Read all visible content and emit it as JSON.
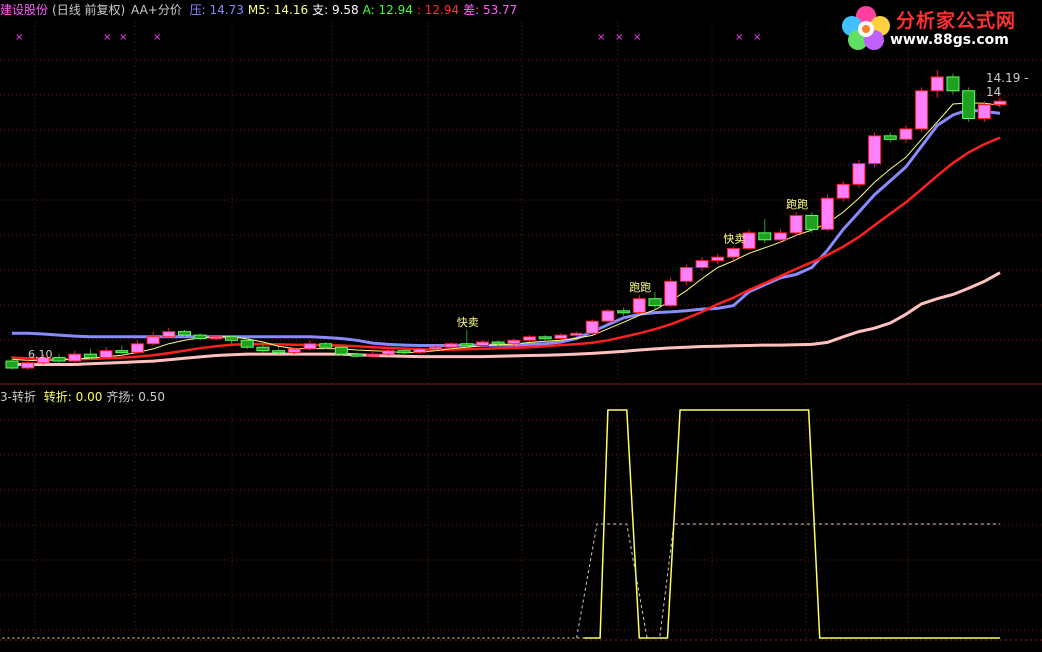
{
  "header": {
    "stock_name": "建设股份",
    "period": "(日线 前复权)",
    "indicator": "AA+分价",
    "items": [
      {
        "label": "压:",
        "value": "14.73",
        "color": "#8a8aff"
      },
      {
        "label": "M5:",
        "value": "14.16",
        "color": "#ffff80"
      },
      {
        "label": "支:",
        "value": "9.58",
        "color": "#ffffff"
      },
      {
        "label": "A:",
        "value": "12.94",
        "color": "#40ff40"
      },
      {
        "label": ":",
        "value": "12.94",
        "color": "#ff3030"
      },
      {
        "label": "差:",
        "value": "53.77",
        "color": "#ff60ff"
      }
    ]
  },
  "logo": {
    "title": "分析家公式网",
    "url": "www.88gs.com"
  },
  "price_labels": {
    "low_marker": "6.10",
    "high_marker": "14.19 - 14"
  },
  "signals": [
    {
      "text": "快卖",
      "day": 29
    },
    {
      "text": "跑跑",
      "day": 40
    },
    {
      "text": "快卖",
      "day": 46
    },
    {
      "text": "跑跑",
      "day": 50
    }
  ],
  "sub_header": {
    "name": "3-转折",
    "items": [
      {
        "label": "转折:",
        "value": "0.00",
        "color": "#ffff60"
      },
      {
        "label": "齐扬:",
        "value": "0.50",
        "color": "#cccccc"
      }
    ]
  },
  "colors": {
    "background": "#000000",
    "up_candle": "#ff80ff",
    "down_candle": "#20a020",
    "upper_band": "#8a8aff",
    "ma_fast": "#ffff80",
    "ma_mid": "#ff2020",
    "ma_slow": "#ffc0c0",
    "grid": "#6a1a1a",
    "indicator_line": "#ffff60",
    "indicator_dash": "#cccccc"
  },
  "chart_data": {
    "type": "candlestick",
    "days": 64,
    "price_range": [
      6.0,
      14.6
    ],
    "candles": [
      [
        6.2,
        6.0,
        6.35,
        5.95
      ],
      [
        6.0,
        6.15,
        6.25,
        5.95
      ],
      [
        6.15,
        6.3,
        6.4,
        6.1
      ],
      [
        6.3,
        6.2,
        6.4,
        6.15
      ],
      [
        6.2,
        6.4,
        6.5,
        6.15
      ],
      [
        6.4,
        6.3,
        6.55,
        6.25
      ],
      [
        6.3,
        6.5,
        6.6,
        6.25
      ],
      [
        6.5,
        6.45,
        6.65,
        6.4
      ],
      [
        6.45,
        6.7,
        6.8,
        6.4
      ],
      [
        6.7,
        6.9,
        7.05,
        6.65
      ],
      [
        6.9,
        7.05,
        7.15,
        6.85
      ],
      [
        7.05,
        6.95,
        7.1,
        6.9
      ],
      [
        6.95,
        6.85,
        7.0,
        6.8
      ],
      [
        6.85,
        6.9,
        6.95,
        6.8
      ],
      [
        6.9,
        6.8,
        6.95,
        6.7
      ],
      [
        6.8,
        6.6,
        6.85,
        6.55
      ],
      [
        6.6,
        6.5,
        6.7,
        6.45
      ],
      [
        6.5,
        6.45,
        6.6,
        6.4
      ],
      [
        6.45,
        6.55,
        6.6,
        6.4
      ],
      [
        6.55,
        6.7,
        6.8,
        6.5
      ],
      [
        6.7,
        6.6,
        6.75,
        6.55
      ],
      [
        6.6,
        6.4,
        6.65,
        6.35
      ],
      [
        6.4,
        6.35,
        6.45,
        6.3
      ],
      [
        6.35,
        6.4,
        6.5,
        6.3
      ],
      [
        6.4,
        6.5,
        6.55,
        6.35
      ],
      [
        6.5,
        6.45,
        6.55,
        6.4
      ],
      [
        6.45,
        6.55,
        6.6,
        6.4
      ],
      [
        6.55,
        6.6,
        6.65,
        6.5
      ],
      [
        6.6,
        6.7,
        6.75,
        6.55
      ],
      [
        6.7,
        6.65,
        7.1,
        6.6
      ],
      [
        6.65,
        6.75,
        6.8,
        6.6
      ],
      [
        6.75,
        6.7,
        6.8,
        6.65
      ],
      [
        6.7,
        6.8,
        6.85,
        6.65
      ],
      [
        6.8,
        6.9,
        6.95,
        6.75
      ],
      [
        6.9,
        6.85,
        6.95,
        6.8
      ],
      [
        6.85,
        6.95,
        7.0,
        6.8
      ],
      [
        6.95,
        7.0,
        7.05,
        6.9
      ],
      [
        7.0,
        7.35,
        7.4,
        6.95
      ],
      [
        7.35,
        7.65,
        7.7,
        7.3
      ],
      [
        7.65,
        7.6,
        7.75,
        7.5
      ],
      [
        7.6,
        8.0,
        8.1,
        7.55
      ],
      [
        8.0,
        7.8,
        8.2,
        7.7
      ],
      [
        7.8,
        8.5,
        8.6,
        7.75
      ],
      [
        8.5,
        8.9,
        9.0,
        8.4
      ],
      [
        8.9,
        9.1,
        9.2,
        8.8
      ],
      [
        9.1,
        9.2,
        9.3,
        9.0
      ],
      [
        9.2,
        9.45,
        9.5,
        9.1
      ],
      [
        9.45,
        9.9,
        10.0,
        9.4
      ],
      [
        9.9,
        9.7,
        10.3,
        9.6
      ],
      [
        9.7,
        9.9,
        10.0,
        9.6
      ],
      [
        9.9,
        10.4,
        10.5,
        9.8
      ],
      [
        10.4,
        10.0,
        10.5,
        9.9
      ],
      [
        10.0,
        10.9,
        11.0,
        9.95
      ],
      [
        10.9,
        11.3,
        11.4,
        10.8
      ],
      [
        11.3,
        11.9,
        12.0,
        11.2
      ],
      [
        11.9,
        12.7,
        12.8,
        11.8
      ],
      [
        12.7,
        12.6,
        12.8,
        12.5
      ],
      [
        12.6,
        12.9,
        13.0,
        12.5
      ],
      [
        12.9,
        14.0,
        14.1,
        12.8
      ],
      [
        14.0,
        14.4,
        14.6,
        13.8
      ],
      [
        14.4,
        14.0,
        14.5,
        13.9
      ],
      [
        14.0,
        13.2,
        14.1,
        13.1
      ],
      [
        13.2,
        13.6,
        13.7,
        13.1
      ],
      [
        13.6,
        13.7,
        13.8,
        13.5
      ]
    ],
    "upper_band": [
      7.0,
      7.0,
      6.98,
      6.95,
      6.92,
      6.9,
      6.9,
      6.9,
      6.9,
      6.9,
      6.9,
      6.9,
      6.9,
      6.9,
      6.9,
      6.9,
      6.9,
      6.9,
      6.9,
      6.9,
      6.88,
      6.85,
      6.8,
      6.72,
      6.68,
      6.66,
      6.65,
      6.65,
      6.65,
      6.66,
      6.66,
      6.66,
      6.66,
      6.68,
      6.7,
      6.75,
      6.85,
      7.05,
      7.25,
      7.45,
      7.55,
      7.6,
      7.62,
      7.65,
      7.7,
      7.72,
      7.8,
      8.2,
      8.4,
      8.6,
      8.7,
      8.9,
      9.4,
      10.0,
      10.5,
      11.0,
      11.4,
      11.8,
      12.4,
      13.0,
      13.3,
      13.45,
      13.4,
      13.35
    ],
    "ma_fast": [
      6.25,
      6.22,
      6.22,
      6.23,
      6.26,
      6.28,
      6.33,
      6.37,
      6.45,
      6.55,
      6.7,
      6.8,
      6.87,
      6.9,
      6.9,
      6.84,
      6.75,
      6.63,
      6.56,
      6.56,
      6.56,
      6.55,
      6.52,
      6.5,
      6.48,
      6.44,
      6.46,
      6.5,
      6.56,
      6.6,
      6.64,
      6.67,
      6.68,
      6.74,
      6.77,
      6.8,
      6.86,
      6.94,
      7.13,
      7.32,
      7.52,
      7.68,
      7.93,
      8.23,
      8.58,
      8.9,
      9.09,
      9.31,
      9.47,
      9.63,
      9.83,
      9.98,
      10.18,
      10.5,
      10.9,
      11.36,
      11.74,
      12.08,
      12.6,
      13.1,
      13.62,
      13.65,
      13.64,
      13.58
    ],
    "ma_mid": [
      6.3,
      6.28,
      6.26,
      6.25,
      6.25,
      6.26,
      6.28,
      6.3,
      6.33,
      6.37,
      6.43,
      6.5,
      6.57,
      6.63,
      6.67,
      6.69,
      6.69,
      6.68,
      6.67,
      6.66,
      6.66,
      6.65,
      6.63,
      6.6,
      6.58,
      6.56,
      6.54,
      6.53,
      6.53,
      6.54,
      6.55,
      6.57,
      6.58,
      6.6,
      6.63,
      6.66,
      6.69,
      6.73,
      6.8,
      6.9,
      7.0,
      7.12,
      7.26,
      7.43,
      7.62,
      7.84,
      8.03,
      8.25,
      8.45,
      8.65,
      8.86,
      9.05,
      9.26,
      9.5,
      9.78,
      10.12,
      10.45,
      10.78,
      11.16,
      11.55,
      11.92,
      12.22,
      12.46,
      12.65
    ],
    "ma_slow": [
      6.1,
      6.1,
      6.1,
      6.1,
      6.1,
      6.12,
      6.14,
      6.16,
      6.18,
      6.2,
      6.24,
      6.28,
      6.32,
      6.36,
      6.38,
      6.4,
      6.4,
      6.4,
      6.4,
      6.4,
      6.4,
      6.4,
      6.38,
      6.36,
      6.35,
      6.34,
      6.33,
      6.33,
      6.33,
      6.33,
      6.33,
      6.34,
      6.35,
      6.36,
      6.37,
      6.38,
      6.4,
      6.42,
      6.45,
      6.48,
      6.52,
      6.55,
      6.58,
      6.6,
      6.62,
      6.63,
      6.64,
      6.65,
      6.66,
      6.66,
      6.67,
      6.68,
      6.74,
      6.9,
      7.05,
      7.15,
      7.3,
      7.55,
      7.85,
      8.0,
      8.12,
      8.3,
      8.5,
      8.75
    ],
    "sub_chart": {
      "name": "3-转折",
      "range": [
        0,
        1
      ],
      "zhuanzhe": [
        0,
        0,
        0,
        0,
        0,
        0,
        0,
        0,
        0,
        0,
        0,
        0,
        0,
        0,
        0,
        0,
        0,
        0,
        0,
        0,
        0,
        0,
        0,
        0,
        0,
        0,
        0,
        0,
        0,
        0,
        0,
        0,
        0,
        0,
        0,
        0,
        0,
        0,
        0,
        0,
        0,
        0,
        0,
        0,
        0,
        0,
        0,
        0,
        0,
        0,
        0,
        0,
        0,
        0,
        0,
        0,
        0,
        0,
        0,
        0,
        0,
        0,
        0,
        0
      ],
      "segments": [
        {
          "from": 36.5,
          "to": 37.5,
          "level": 0
        },
        {
          "from": 37.5,
          "to": 38.0,
          "level": 1
        },
        {
          "from": 38.0,
          "to": 39.2,
          "level": 1
        },
        {
          "from": 39.2,
          "to": 40.0,
          "level": 0
        },
        {
          "from": 40.0,
          "to": 41.8,
          "level": 0
        },
        {
          "from": 41.8,
          "to": 42.6,
          "level": 1
        },
        {
          "from": 42.6,
          "to": 50.8,
          "level": 1
        },
        {
          "from": 50.8,
          "to": 51.5,
          "level": 0
        },
        {
          "from": 51.5,
          "to": 63.0,
          "level": 0
        }
      ],
      "qiyang_level": 0.5,
      "qiyang_segments": [
        {
          "from": 36.0,
          "to": 37.3
        },
        {
          "from": 37.3,
          "to": 39.2,
          "flat": true
        },
        {
          "from": 39.2,
          "to": 40.5
        },
        {
          "from": 41.3,
          "to": 42.2
        },
        {
          "from": 42.2,
          "to": 63.0,
          "flat": true
        }
      ]
    }
  }
}
